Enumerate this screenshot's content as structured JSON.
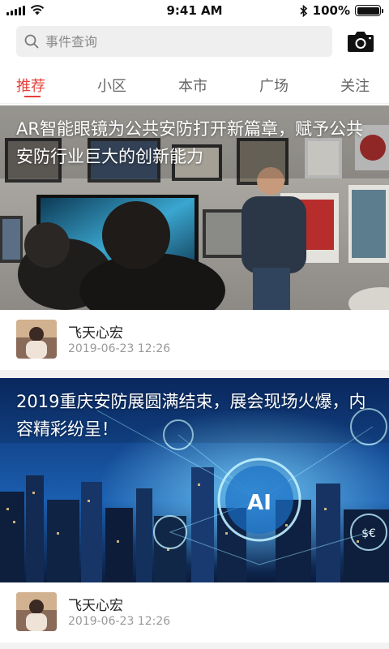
{
  "status_bar": {
    "time": "9:41 AM",
    "battery_text": "100%",
    "battery_level": 1.0
  },
  "search": {
    "placeholder": "事件查询"
  },
  "tabs": [
    {
      "label": "推荐",
      "active": true
    },
    {
      "label": "小区",
      "active": false
    },
    {
      "label": "本市",
      "active": false
    },
    {
      "label": "广场",
      "active": false
    },
    {
      "label": "关注",
      "active": false
    }
  ],
  "articles": [
    {
      "title": "AR智能眼镜为公共安防打开新篇章，赋予公共安防行业巨大的创新能力",
      "author": "飞天心宏",
      "date": "2019-06-23 12:26"
    },
    {
      "title": "2019重庆安防展圆满结束，展会现场火爆，内容精彩纷呈！",
      "author": "飞天心宏",
      "date": "2019-06-23 12:26"
    }
  ],
  "colors": {
    "accent": "#e5403a",
    "search_bg": "#efefef",
    "separator": "#f2f2f2"
  },
  "icons": [
    "signal-icon",
    "wifi-icon",
    "bluetooth-icon",
    "battery-icon",
    "search-icon",
    "camera-icon",
    "ai-brain-icon"
  ]
}
